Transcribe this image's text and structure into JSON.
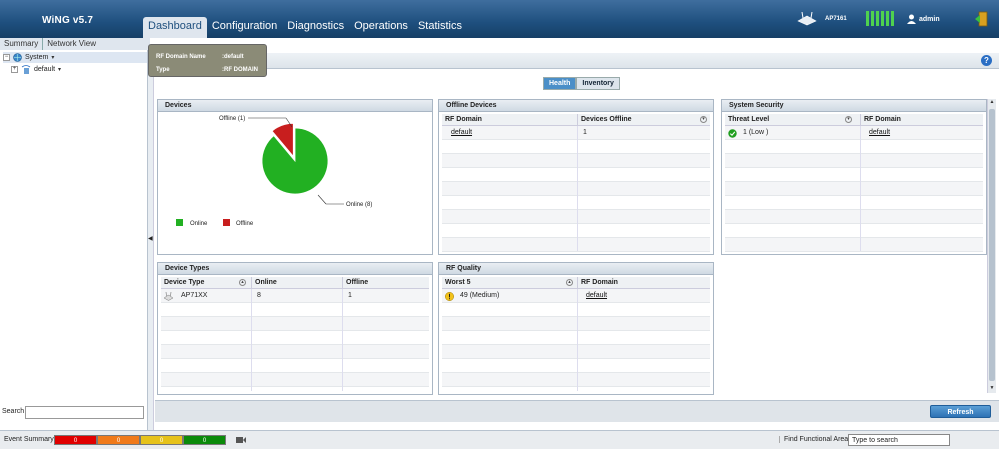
{
  "header": {
    "brand": "WiNG v5.7",
    "nav": [
      "Dashboard",
      "Configuration",
      "Diagnostics",
      "Operations",
      "Statistics"
    ],
    "device_name": "AP7161",
    "user": "admin"
  },
  "tooltip": {
    "rows": [
      {
        "key": "RF Domain Name",
        "value": ":default"
      },
      {
        "key": "Type",
        "value": ":RF DOMAIN"
      }
    ]
  },
  "left": {
    "tabs": [
      "Summary",
      "Network View"
    ],
    "tree": [
      {
        "label": "System",
        "toggle": "−"
      },
      {
        "label": "default",
        "toggle": "+"
      }
    ],
    "search_label": "Search"
  },
  "main": {
    "tabs": [
      "Health",
      "Inventory"
    ],
    "devices_panel": {
      "title": "Devices",
      "callouts": {
        "offline": "Offline (1)",
        "online": "Online (8)"
      },
      "legend": [
        "Online",
        "Offline"
      ]
    },
    "offline_devices": {
      "title": "Offline Devices",
      "columns": [
        "RF Domain",
        "Devices Offline"
      ],
      "rows": [
        [
          "default",
          "1"
        ]
      ]
    },
    "system_security": {
      "title": "System Security",
      "columns": [
        "Threat Level",
        "RF Domain"
      ],
      "rows": [
        [
          "1 (Low )",
          "default"
        ]
      ]
    },
    "device_types": {
      "title": "Device Types",
      "columns": [
        "Device Type",
        "Online",
        "Offline"
      ],
      "rows": [
        [
          "AP71XX",
          "8",
          "1"
        ]
      ]
    },
    "rf_quality": {
      "title": "RF Quality",
      "columns": [
        "Worst 5",
        "RF Domain"
      ],
      "rows": [
        [
          "49 (Medium)",
          "default"
        ]
      ]
    },
    "refresh_label": "Refresh"
  },
  "status": {
    "event_label": "Event Summary",
    "events": [
      {
        "count": "0",
        "color": "#e00000"
      },
      {
        "count": "0",
        "color": "#f07a1a"
      },
      {
        "count": "0",
        "color": "#e6c21a"
      },
      {
        "count": "0",
        "color": "#0a8a0a"
      }
    ],
    "ffa_label": "Find Functional Area",
    "ffa_placeholder": "Type to search"
  },
  "chart_data": {
    "type": "pie",
    "categories": [
      "Online",
      "Offline"
    ],
    "values": [
      8,
      1
    ],
    "colors": [
      "#22b022",
      "#c81e1e"
    ],
    "title": "",
    "legend_position": "bottom-left"
  }
}
